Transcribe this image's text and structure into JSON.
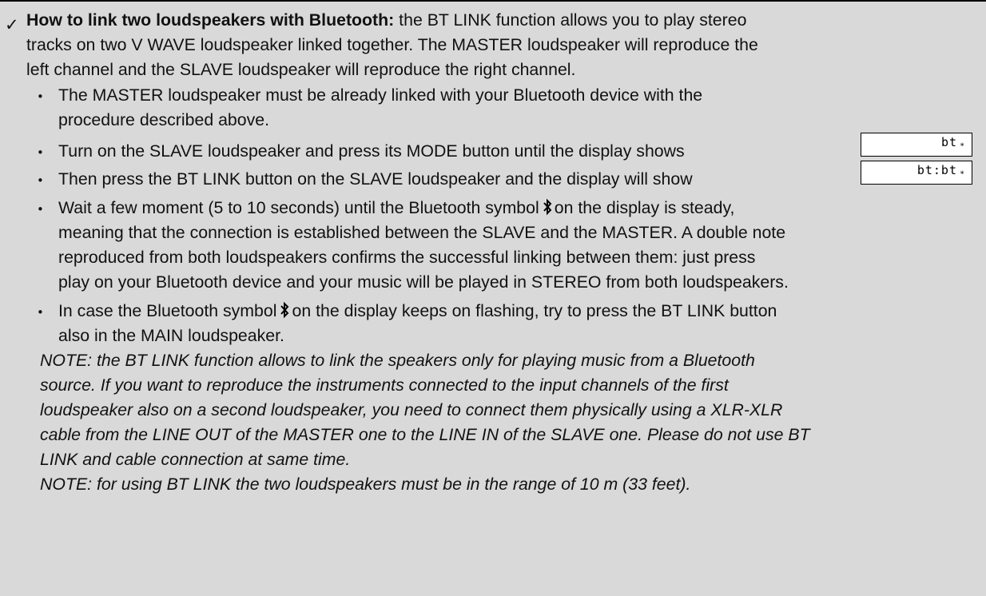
{
  "section": {
    "heading": "How to link two loudspeakers with Bluetooth:",
    "intro": [
      " the BT LINK function allows you to play stereo",
      "tracks on two V WAVE loudspeaker linked together. The MASTER loudspeaker will reproduce the",
      "left channel and the SLAVE loudspeaker will reproduce the right channel."
    ]
  },
  "bullets": {
    "b1": [
      "The MASTER loudspeaker must be already linked with your Bluetooth device with the",
      "procedure described above."
    ],
    "b2": "Turn on the SLAVE loudspeaker and press its MODE button until the display shows",
    "b3": "Then press the BT LINK button on the SLAVE loudspeaker and the display will show",
    "b4": {
      "line1a": "Wait a few moment (5 to 10 seconds) until the Bluetooth symbol",
      "line1b": "on the display is steady,",
      "lines": [
        "meaning that the connection is established between the SLAVE and the MASTER. A double note",
        "reproduced from both loudspeakers confirms the successful linking between them: just press",
        "play on your Bluetooth device and your music will be played in STEREO from both loudspeakers."
      ]
    },
    "b5": {
      "line1a": "In case the Bluetooth symbol",
      "line1b": "on the display keeps on flashing, try to press the BT LINK button",
      "line2": "also in the MAIN loudspeaker."
    }
  },
  "displays": {
    "bt_mode": "bt",
    "bt_link": "bt:bt"
  },
  "notes": [
    "NOTE: the BT LINK function allows to link the speakers only for playing music from a Bluetooth",
    "source. If you want to reproduce the instruments connected to the input channels of the first",
    "loudspeaker also on a second loudspeaker, you need to connect them physically using a XLR-XLR",
    "cable from the LINE OUT of the MASTER one to the LINE IN of the SLAVE one. Please do not use BT",
    "LINK and cable connection at same time.",
    "NOTE: for using BT LINK the two loudspeakers must be in the range of 10 m (33 feet)."
  ],
  "icons": {
    "check": "check-icon",
    "bluetooth": "bluetooth-icon"
  }
}
